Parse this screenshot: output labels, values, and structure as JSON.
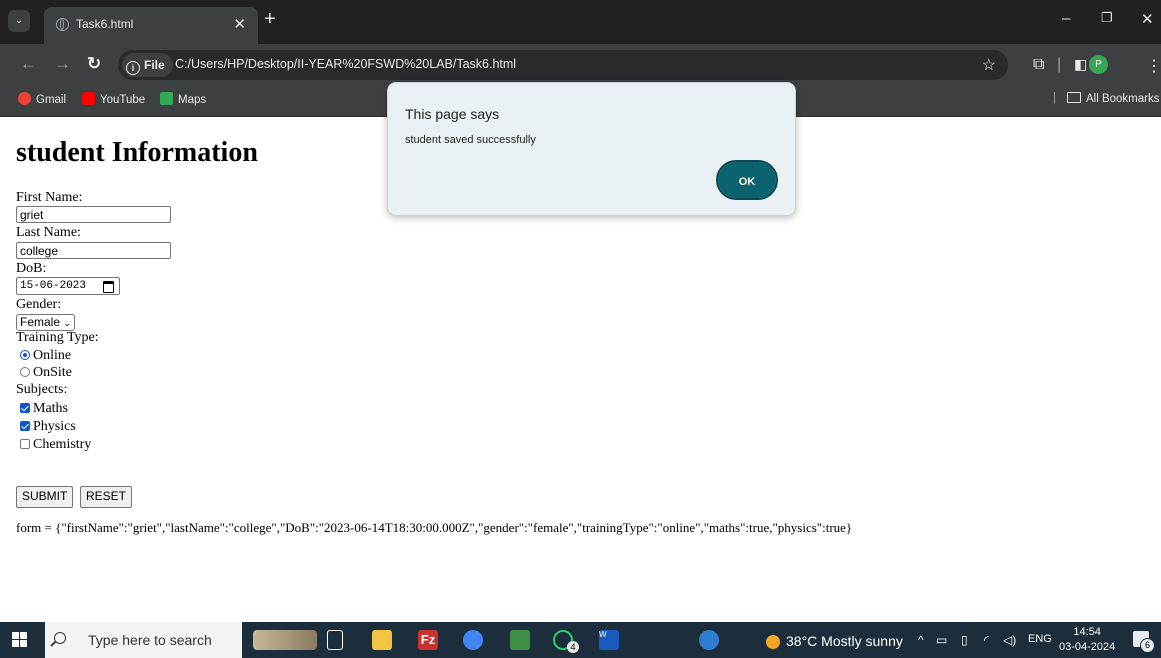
{
  "browser": {
    "tab_title": "Task6.html",
    "url_scheme_label": "File",
    "url": "C:/Users/HP/Desktop/II-YEAR%20FSWD%20LAB/Task6.html",
    "profile_initial": "P",
    "bookmarks": [
      {
        "label": "Gmail",
        "icon": "gmail-icon",
        "color": "#ea4335"
      },
      {
        "label": "YouTube",
        "icon": "youtube-icon",
        "color": "#ff0000"
      },
      {
        "label": "Maps",
        "icon": "maps-icon",
        "color": "#34a853"
      }
    ],
    "all_bookmarks_label": "All Bookmarks"
  },
  "page": {
    "heading": "student Information",
    "first_name_label": "First Name:",
    "first_name_value": "griet",
    "last_name_label": "Last Name:",
    "last_name_value": "college",
    "dob_label": "DoB:",
    "dob_value": "15-06-2023",
    "gender_label": "Gender:",
    "gender_value": "Female",
    "training_label": "Training Type:",
    "training_options": [
      {
        "label": "Online",
        "selected": true
      },
      {
        "label": "OnSite",
        "selected": false
      }
    ],
    "subjects_label": "Subjects:",
    "subjects": [
      {
        "label": "Maths",
        "checked": true
      },
      {
        "label": "Physics",
        "checked": true
      },
      {
        "label": "Chemistry",
        "checked": false
      }
    ],
    "submit_label": "SUBMIT",
    "reset_label": "RESET",
    "result_text": "form = {\"firstName\":\"griet\",\"lastName\":\"college\",\"DoB\":\"2023-06-14T18:30:00.000Z\",\"gender\":\"female\",\"trainingType\":\"online\",\"maths\":true,\"physics\":true}"
  },
  "dialog": {
    "title": "This page says",
    "message": "student saved successfully",
    "ok_label": "OK",
    "accent": "#0b6370"
  },
  "taskbar": {
    "search_placeholder": "Type here to search",
    "whatsapp_badge": "4",
    "weather": "38°C  Mostly sunny",
    "language": "ENG",
    "time": "14:54",
    "date": "03-04-2024",
    "notification_count": "6"
  }
}
